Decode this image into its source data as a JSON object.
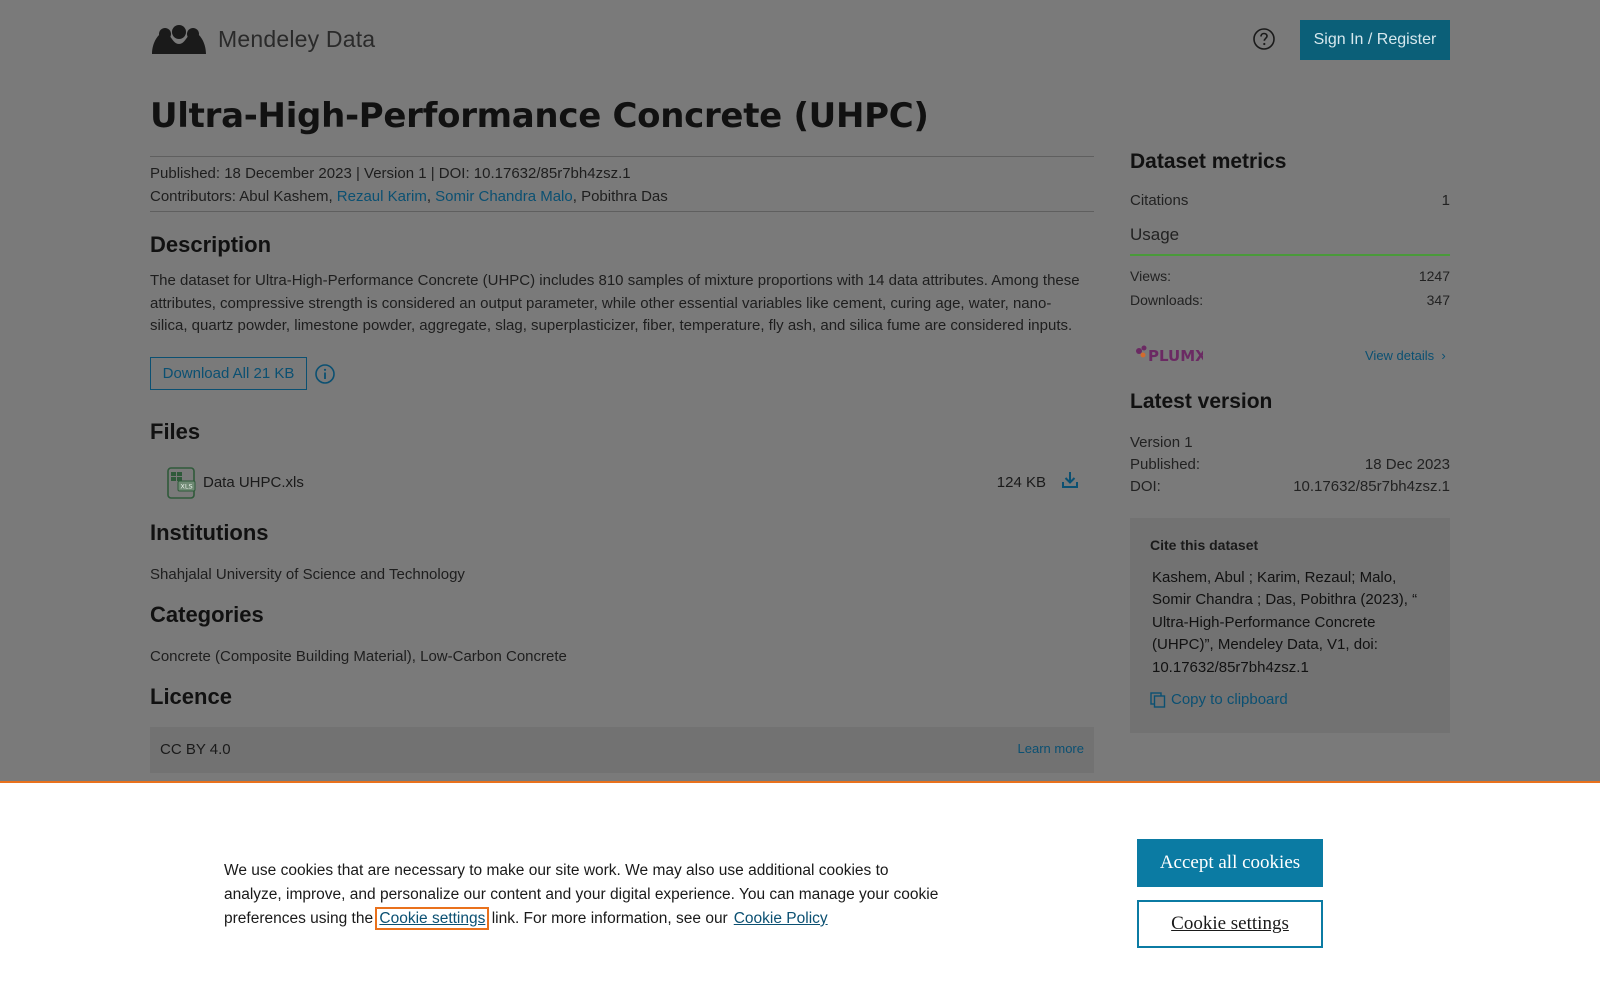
{
  "header": {
    "logo_text": "Mendeley Data",
    "signin_label": "Sign In / Register"
  },
  "dataset": {
    "title": "Ultra-High-Performance Concrete (UHPC)",
    "published_line": "Published: 18 December 2023 | Version 1 | DOI: 10.17632/85r7bh4zsz.1",
    "contributors_label": "Contributors:",
    "contributors": [
      {
        "name": "Abul Kashem",
        "linked": false
      },
      {
        "name": "Rezaul Karim",
        "linked": true
      },
      {
        "name": "Somir Chandra Malo",
        "linked": true
      },
      {
        "name": "Pobithra Das",
        "linked": false
      }
    ]
  },
  "description": {
    "heading": "Description",
    "text": "The dataset for Ultra-High-Performance Concrete (UHPC) includes 810 samples of mixture proportions with 14 data attributes. Among these attributes, compressive strength is considered an output parameter, while other essential variables like cement, curing age, water, nano-silica, quartz powder, limestone powder, aggregate, slag, superplasticizer, fiber, temperature, fly ash, and silica fume are considered inputs.",
    "download_label": "Download All 21 KB"
  },
  "files": {
    "heading": "Files",
    "items": [
      {
        "name": "Data UHPC.xls",
        "size": "124 KB"
      }
    ]
  },
  "institutions": {
    "heading": "Institutions",
    "text": "Shahjalal University of Science and Technology"
  },
  "categories": {
    "heading": "Categories",
    "text": "Concrete (Composite Building Material), Low-Carbon Concrete"
  },
  "licence": {
    "heading": "Licence",
    "name": "CC BY 4.0",
    "learn_more": "Learn more"
  },
  "metrics": {
    "heading": "Dataset metrics",
    "citations_label": "Citations",
    "citations_value": "1",
    "usage_heading": "Usage",
    "views_label": "Views:",
    "views_value": "1247",
    "downloads_label": "Downloads:",
    "downloads_value": "347",
    "view_details": "View details"
  },
  "latest": {
    "heading": "Latest version",
    "version": "Version 1",
    "published_label": "Published:",
    "published_value": "18 Dec 2023",
    "doi_label": "DOI:",
    "doi_value": "10.17632/85r7bh4zsz.1"
  },
  "cite": {
    "heading": "Cite this dataset",
    "text": "Kashem, Abul ;  Karim, Rezaul; Malo, Somir Chandra ; Das, Pobithra (2023), “ Ultra-High-Performance Concrete (UHPC)”, Mendeley Data, V1, doi: 10.17632/85r7bh4zsz.1",
    "copy_label": "Copy to clipboard"
  },
  "cookie": {
    "text_before": "We use cookies that are necessary to make our site work. We may also use additional cookies to analyze, improve, and personalize our content and your digital experience. You can manage your cookie preferences using the",
    "settings_link": "Cookie settings",
    "text_after": "link. For more information, see our",
    "policy_link": "Cookie Policy",
    "accept_label": "Accept all cookies",
    "settings_label": "Cookie settings"
  },
  "colors": {
    "primary": "#0b5f78",
    "link": "#0b5072",
    "accent_orange": "#e9711c",
    "usage_green": "#4a9a3a",
    "overlay_bg": "#7a7a7a"
  }
}
